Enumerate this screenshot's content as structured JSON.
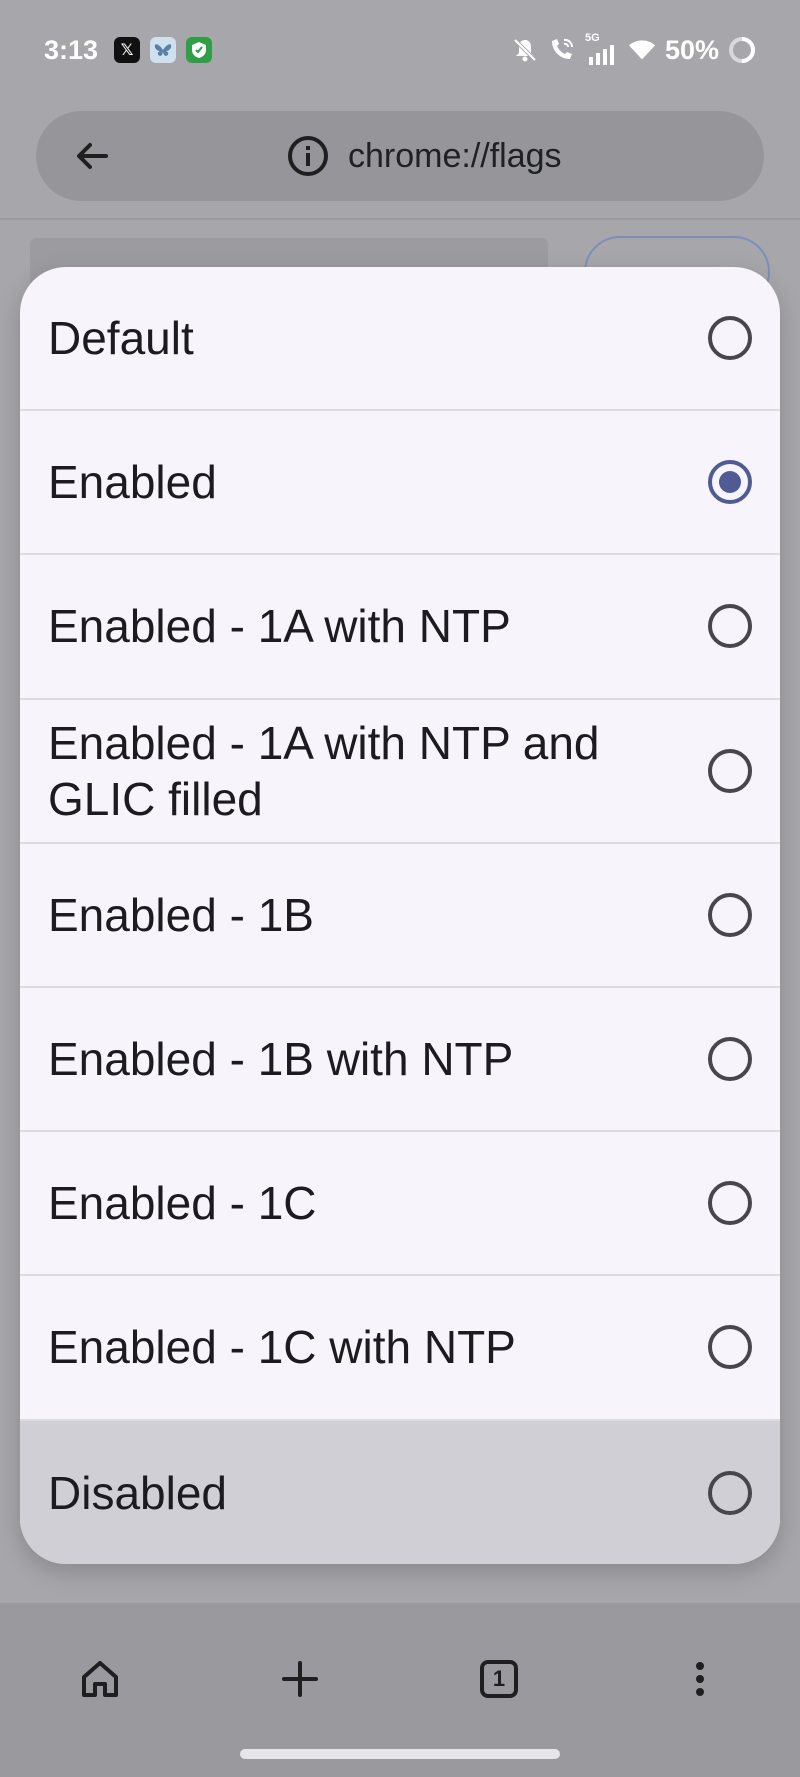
{
  "status_bar": {
    "time": "3:13",
    "battery": "50%",
    "network": "5G",
    "notification_apps": [
      "x-icon",
      "bluesky-icon",
      "shield-app-icon"
    ],
    "system_icons": [
      "muted-bell-icon",
      "wifi-call-icon",
      "signal-icon",
      "wifi-icon",
      "battery-ring-icon"
    ]
  },
  "toolbar": {
    "url": "chrome://flags",
    "back_icon": "arrow-left-icon",
    "site_info_icon": "info-icon"
  },
  "sheet": {
    "options": [
      {
        "label": "Default",
        "selected": false
      },
      {
        "label": "Enabled",
        "selected": true
      },
      {
        "label": "Enabled - 1A with NTP",
        "selected": false
      },
      {
        "label": "Enabled - 1A with NTP and GLIC filled",
        "selected": false
      },
      {
        "label": "Enabled - 1B",
        "selected": false
      },
      {
        "label": "Enabled - 1B with NTP",
        "selected": false
      },
      {
        "label": "Enabled - 1C",
        "selected": false
      },
      {
        "label": "Enabled - 1C with NTP",
        "selected": false
      },
      {
        "label": "Disabled",
        "selected": false
      }
    ]
  },
  "bottom_nav": {
    "home_icon": "home-icon",
    "new_tab_icon": "plus-icon",
    "tab_count": "1",
    "menu_icon": "more-vertical-icon"
  },
  "colors": {
    "accent": "#4f5b92",
    "sheet_background": "#f7f5fb",
    "scrim": "#a7a7ab"
  }
}
